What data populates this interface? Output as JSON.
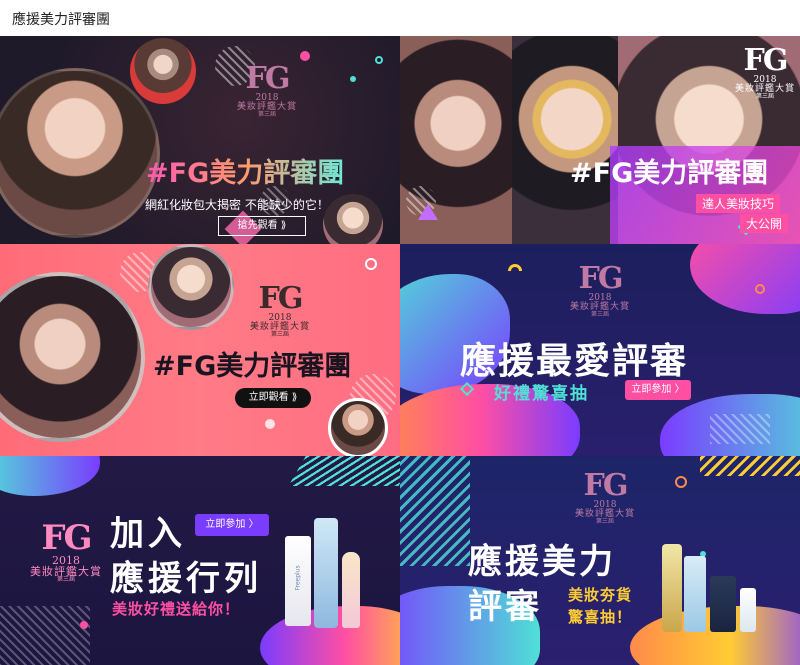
{
  "page": {
    "title": "應援美力評審團"
  },
  "logo": {
    "fg": "FG",
    "year": "2018",
    "award": "美妝評鑑大賞",
    "sub": "第三屆"
  },
  "banner1": {
    "headline_hash": "#",
    "headline_fg": "FG",
    "headline_rest": "美力評審團",
    "subline": "網紅化妝包大揭密  不能缺少的它！",
    "button": "搶先觀看 ⟫"
  },
  "banner2": {
    "headline_hash": "#",
    "headline_fg": "FG",
    "headline_rest": "美力評審團",
    "tag_line1": "達人美妝技巧",
    "tag_line2": "大公開"
  },
  "banner3": {
    "headline_hash": "#",
    "headline_fg": "FG",
    "headline_rest": "美力評審團",
    "button": "立即觀看 ⟫"
  },
  "banner4": {
    "headline": "應援最愛評審",
    "subline": "好禮驚喜抽",
    "button": "立即參加 〉"
  },
  "banner5": {
    "headline_line1": "加入",
    "headline_line2": "應援行列",
    "button": "立即參加 〉",
    "subline": "美妝好禮送給你！",
    "product_label": "Freeplus"
  },
  "banner6": {
    "headline_line1": "應援美力",
    "headline_line2": "評審",
    "sub_line1": "美妝夯貨",
    "sub_line2": "驚喜抽！"
  },
  "colors": {
    "pink": "#ff4fa3",
    "cyan": "#4fe0d6",
    "purple": "#7a3cff",
    "orange": "#ff8a4a",
    "yellow": "#ffcc33"
  }
}
